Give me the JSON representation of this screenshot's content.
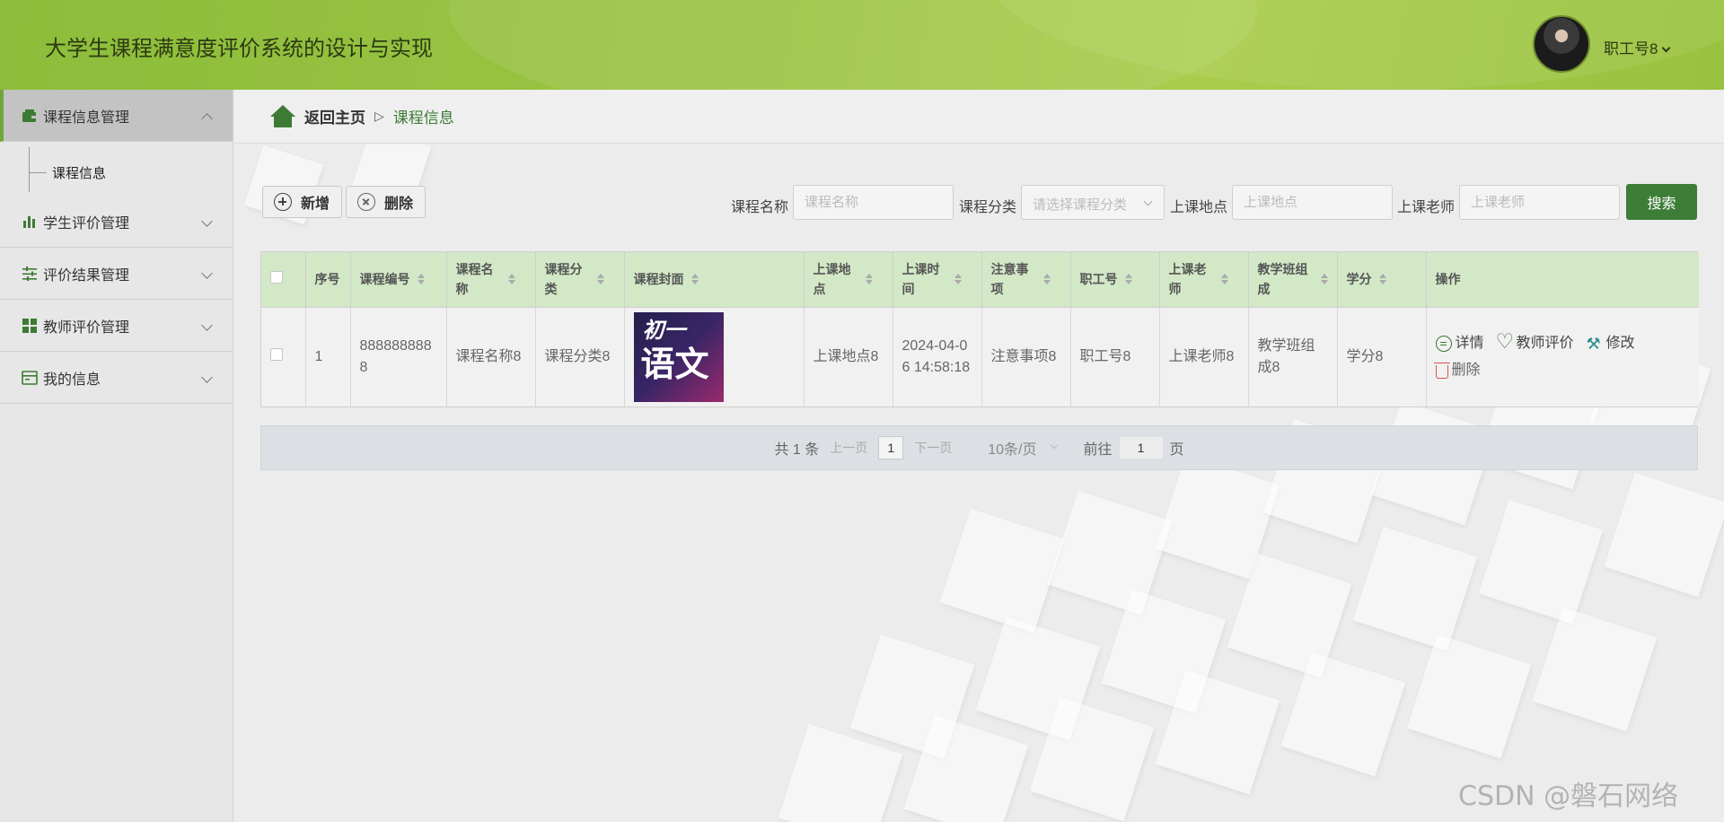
{
  "header": {
    "title": "大学生课程满意度评价系统的设计与实现",
    "user_name": "职工号8"
  },
  "sidebar": {
    "items": [
      {
        "label": "课程信息管理",
        "icon": "wallet-icon",
        "expanded": true,
        "children": [
          {
            "label": "课程信息"
          }
        ]
      },
      {
        "label": "学生评价管理",
        "icon": "bar-chart-icon"
      },
      {
        "label": "评价结果管理",
        "icon": "sliders-icon"
      },
      {
        "label": "教师评价管理",
        "icon": "grid-icon"
      },
      {
        "label": "我的信息",
        "icon": "id-card-icon"
      }
    ]
  },
  "breadcrumb": {
    "home": "返回主页",
    "separator": "▷",
    "current": "课程信息"
  },
  "toolbar": {
    "add_label": "新增",
    "delete_label": "删除"
  },
  "search": {
    "name_label": "课程名称",
    "name_placeholder": "课程名称",
    "category_label": "课程分类",
    "category_placeholder": "请选择课程分类",
    "location_label": "上课地点",
    "location_placeholder": "上课地点",
    "teacher_label": "上课老师",
    "teacher_placeholder": "上课老师",
    "search_button": "搜索"
  },
  "table": {
    "headers": [
      "序号",
      "课程编号",
      "课程名称",
      "课程分类",
      "课程封面",
      "上课地点",
      "上课时间",
      "注意事项",
      "职工号",
      "上课老师",
      "教学班组成",
      "学分",
      "操作"
    ],
    "rows": [
      {
        "index": "1",
        "course_no": "8888888888",
        "course_name": "课程名称8",
        "category": "课程分类8",
        "cover_line1": "初一",
        "cover_line2": "语文",
        "location": "上课地点8",
        "time": "2024-04-06 14:58:18",
        "notes": "注意事项8",
        "staff_no": "职工号8",
        "teacher": "上课老师8",
        "class_group": "教学班组成8",
        "credit": "学分8"
      }
    ],
    "actions": {
      "detail": "详情",
      "teacher_eval": "教师评价",
      "edit": "修改",
      "delete": "删除"
    }
  },
  "pagination": {
    "total": "共 1 条",
    "prev": "上一页",
    "current_page": "1",
    "next": "下一页",
    "page_size": "10条/页",
    "goto_label": "前往",
    "goto_value": "1",
    "goto_suffix": "页"
  },
  "watermark": "CSDN @磐石网络",
  "colors": {
    "header_green": "#9cc544",
    "primary_green": "#3d7d37",
    "table_header_bg": "#d3e8c7",
    "danger": "#d9534f"
  }
}
